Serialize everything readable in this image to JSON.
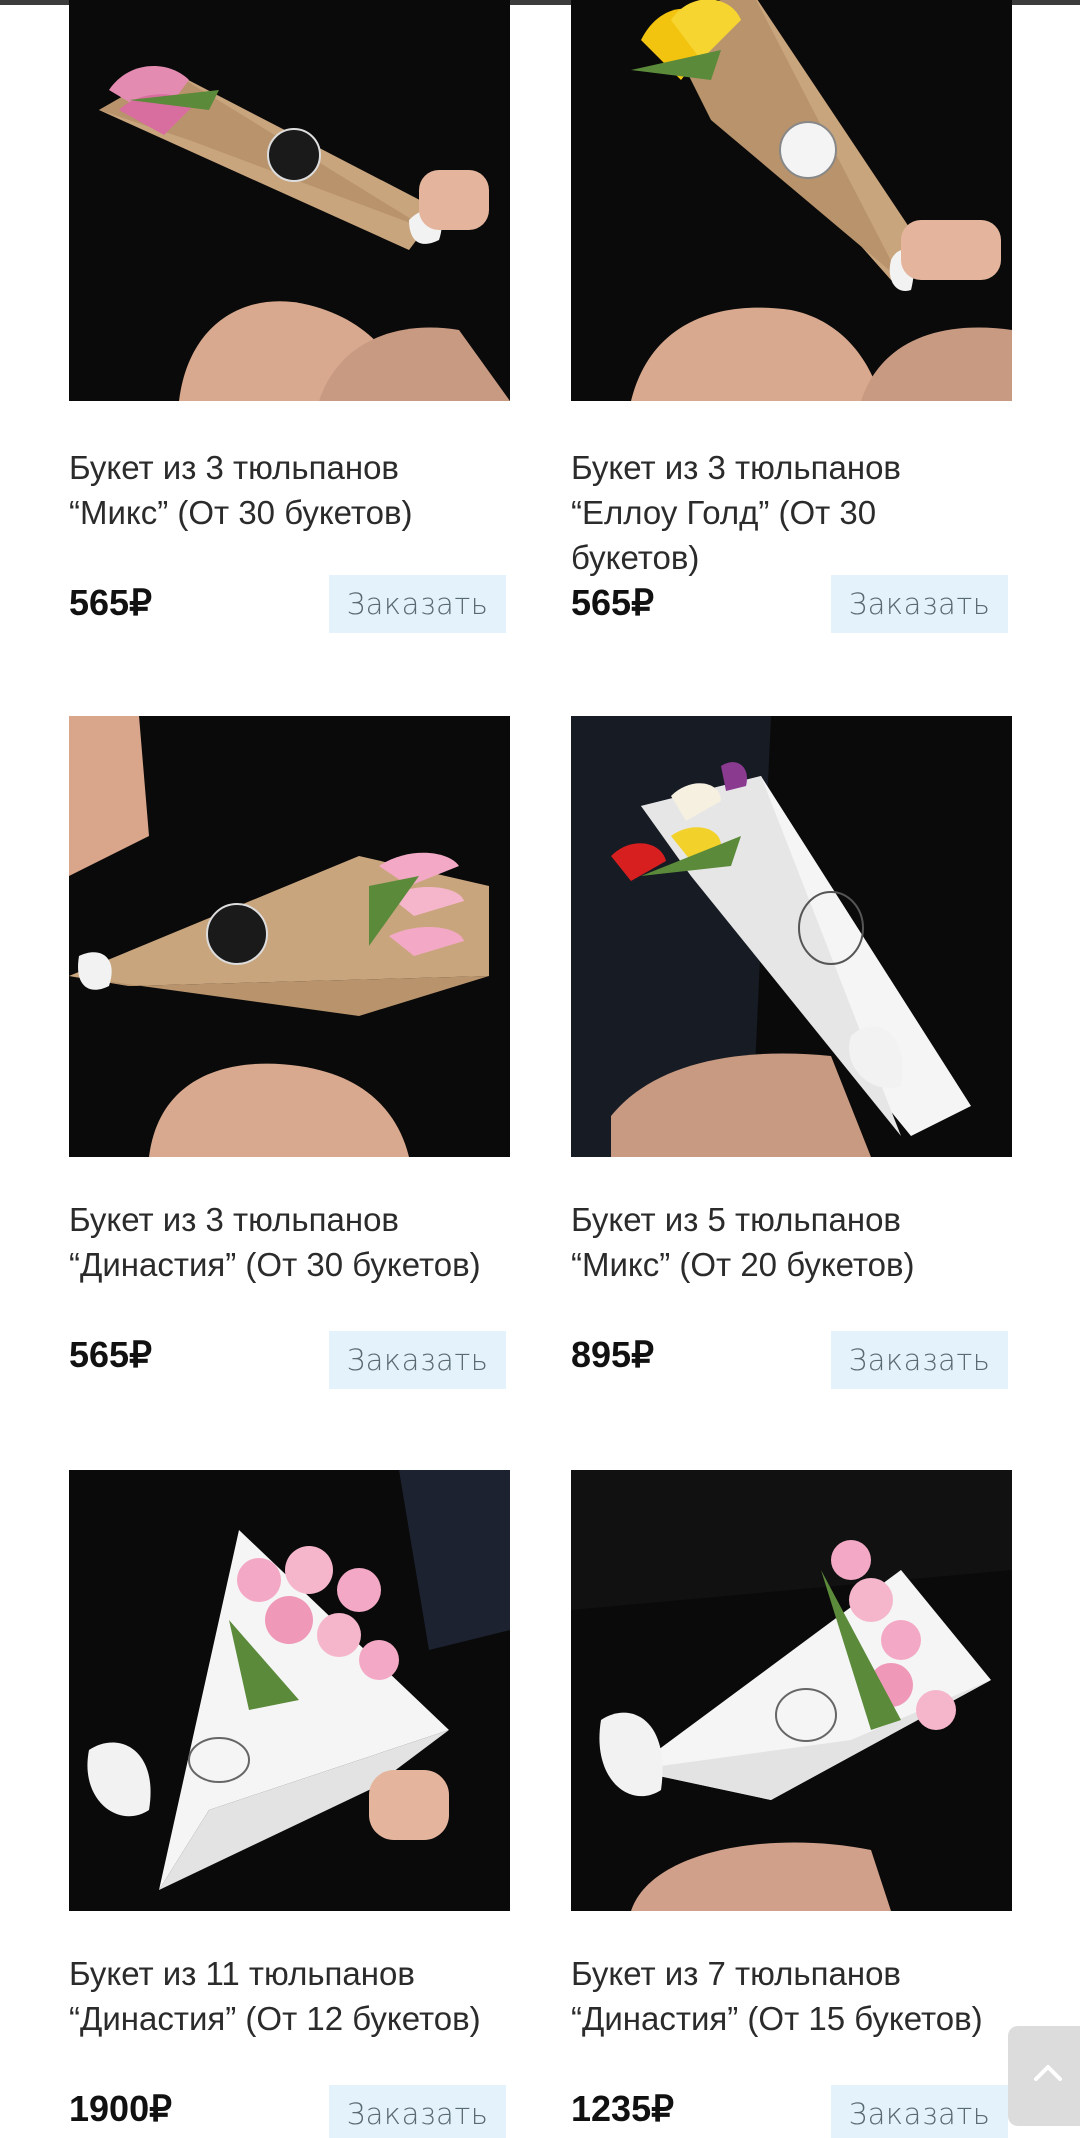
{
  "products": [
    {
      "title_line1": "Букет из 3 тюльпанов",
      "title_line2": "“Микс” (От 30 букетов)",
      "title_line3": "",
      "price": "565₽",
      "button": "Заказать"
    },
    {
      "title_line1": "Букет из 3 тюльпанов",
      "title_line2": "“Еллоу Голд” (От 30",
      "title_line3": "букетов)",
      "price": "565₽",
      "button": "Заказать"
    },
    {
      "title_line1": "Букет из 3 тюльпанов",
      "title_line2": "“Династия” (От 30 букетов)",
      "title_line3": "",
      "price": "565₽",
      "button": "Заказать"
    },
    {
      "title_line1": "Букет из 5 тюльпанов",
      "title_line2": "“Микс” (От 20 букетов)",
      "title_line3": "",
      "price": "895₽",
      "button": "Заказать"
    },
    {
      "title_line1": "Букет из 11 тюльпанов",
      "title_line2": "“Династия” (От 12 букетов)",
      "title_line3": "",
      "price": "1900₽",
      "button": "Заказать"
    },
    {
      "title_line1": "Букет из 7 тюльпанов",
      "title_line2": "“Династия” (От 15 букетов)",
      "title_line3": "",
      "price": "1235₽",
      "button": "Заказать"
    }
  ],
  "colors": {
    "button_bg": "#e3f2fb",
    "button_text": "#5a6a72",
    "price_text": "#111111",
    "title_text": "#2b2b2b",
    "scroll_top_bg": "#dcdcdc"
  },
  "icons": {
    "scroll_top": "chevron-up-icon"
  }
}
